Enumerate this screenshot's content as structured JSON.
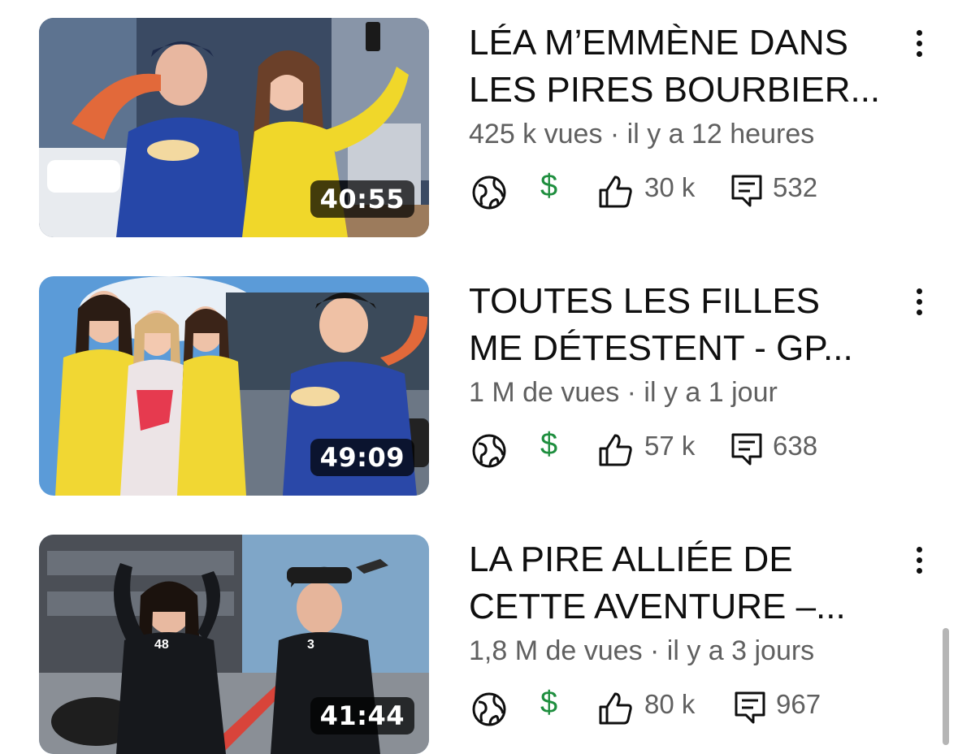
{
  "videos": [
    {
      "title_line1": "LÉA M’EMMÈNE DANS",
      "title_line2": "LES PIRES BOURBIER...",
      "meta": "425 k vues · il y a 12 heures",
      "duration": "40:55",
      "likes": "30 k",
      "comments": "532"
    },
    {
      "title_line1": "TOUTES LES FILLES",
      "title_line2": "ME DÉTESTENT - GP...",
      "meta": "1 M de vues · il y a 1 jour",
      "duration": "49:09",
      "likes": "57 k",
      "comments": "638"
    },
    {
      "title_line1": "LA PIRE ALLIÉE DE",
      "title_line2": "CETTE AVENTURE –...",
      "meta": "1,8 M de vues · il y a 3 jours",
      "duration": "41:44",
      "likes": "80 k",
      "comments": "967"
    }
  ],
  "icons": {
    "visibility": "globe-icon",
    "monetization": "dollar-icon",
    "likes": "thumbs-up-icon",
    "comments": "comment-icon",
    "menu": "more-vertical-icon"
  },
  "colors": {
    "text_primary": "#0f0f0f",
    "text_secondary": "#606060",
    "monetized_green": "#1e8e3e"
  }
}
